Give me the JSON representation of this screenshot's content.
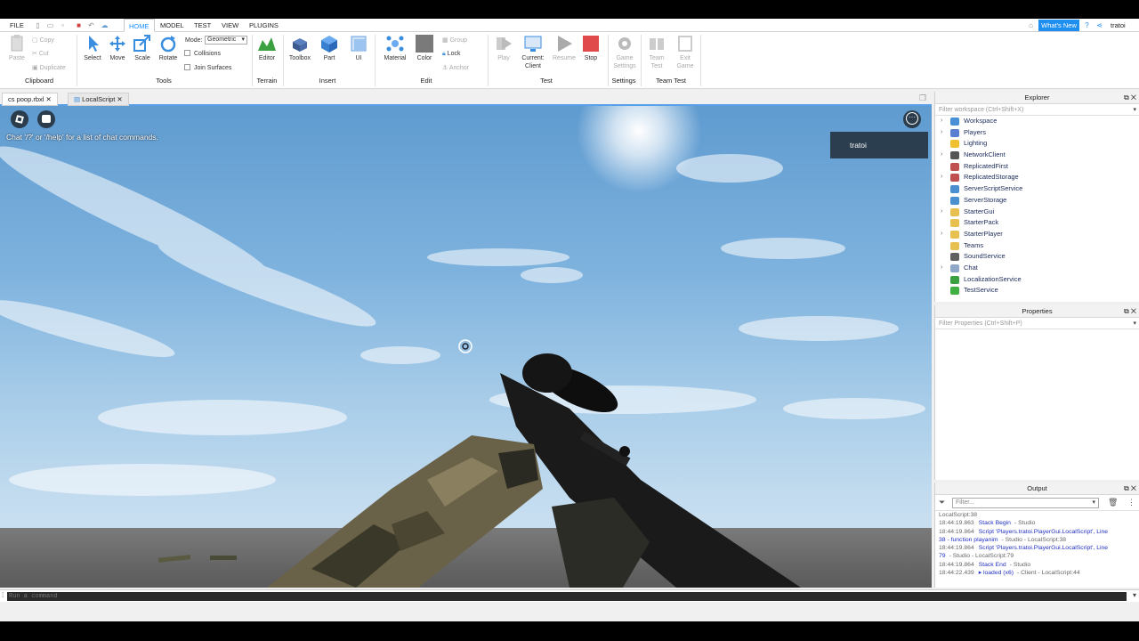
{
  "tabbar": {
    "file": "FILE",
    "tabs": [
      "HOME",
      "MODEL",
      "TEST",
      "VIEW",
      "PLUGINS"
    ],
    "whats_new": "What's New",
    "username": "tratoi"
  },
  "ribbon": {
    "clipboard": {
      "paste": "Paste",
      "copy": "Copy",
      "cut": "Cut",
      "duplicate": "Duplicate",
      "group": "Clipboard"
    },
    "tools": {
      "select": "Select",
      "move": "Move",
      "scale": "Scale",
      "rotate": "Rotate",
      "mode_label": "Mode:",
      "mode_value": "Geometric",
      "collisions": "Collisions",
      "join_surfaces": "Join Surfaces",
      "group": "Tools"
    },
    "terrain": {
      "editor": "Editor",
      "group": "Terrain"
    },
    "insert": {
      "toolbox": "Toolbox",
      "part": "Part",
      "ui": "UI",
      "group": "Insert"
    },
    "edit": {
      "material": "Material",
      "color": "Color",
      "group_btn": "Group",
      "lock": "Lock",
      "anchor": "Anchor",
      "group": "Edit"
    },
    "test": {
      "play": "Play",
      "current": "Current:",
      "client": "Client",
      "resume": "Resume",
      "stop": "Stop",
      "group": "Test"
    },
    "settings": {
      "game": "Game",
      "settings": "Settings",
      "group": "Settings"
    },
    "team_test": {
      "team": "Team",
      "test": "Test",
      "exit": "Exit",
      "game": "Game",
      "group": "Team Test"
    }
  },
  "doc_tabs": [
    {
      "label": "cs poop.rbxl"
    },
    {
      "label": "LocalScript"
    }
  ],
  "viewport": {
    "chat_hint": "Chat '/?' or '/help' for a list of chat commands.",
    "player": "tratoi"
  },
  "explorer": {
    "title": "Explorer",
    "filter": "Filter workspace (Ctrl+Shift+X)",
    "items": [
      {
        "label": "Workspace",
        "expandable": true,
        "icon_color": "#4a90d9"
      },
      {
        "label": "Players",
        "expandable": true,
        "icon_color": "#5a7fd0"
      },
      {
        "label": "Lighting",
        "expandable": false,
        "icon_color": "#f0c030"
      },
      {
        "label": "NetworkClient",
        "expandable": true,
        "icon_color": "#555555"
      },
      {
        "label": "ReplicatedFirst",
        "expandable": false,
        "icon_color": "#c05050"
      },
      {
        "label": "ReplicatedStorage",
        "expandable": true,
        "icon_color": "#c05050"
      },
      {
        "label": "ServerScriptService",
        "expandable": false,
        "icon_color": "#4a8fd0"
      },
      {
        "label": "ServerStorage",
        "expandable": false,
        "icon_color": "#4a8fd0"
      },
      {
        "label": "StarterGui",
        "expandable": true,
        "icon_color": "#e8c050"
      },
      {
        "label": "StarterPack",
        "expandable": false,
        "icon_color": "#e8c050"
      },
      {
        "label": "StarterPlayer",
        "expandable": true,
        "icon_color": "#e8c050"
      },
      {
        "label": "Teams",
        "expandable": false,
        "icon_color": "#e8c050"
      },
      {
        "label": "SoundService",
        "expandable": false,
        "icon_color": "#606060"
      },
      {
        "label": "Chat",
        "expandable": true,
        "icon_color": "#8fa8c8"
      },
      {
        "label": "LocalizationService",
        "expandable": false,
        "icon_color": "#3aa040"
      },
      {
        "label": "TestService",
        "expandable": false,
        "icon_color": "#40b040"
      }
    ]
  },
  "properties": {
    "title": "Properties",
    "filter": "Filter Properties (Ctrl+Shift+P)"
  },
  "output": {
    "title": "Output",
    "filter": "Filter...",
    "lines": [
      {
        "time": "",
        "text": "LocalScript:38",
        "src": ""
      },
      {
        "time": "18:44:19.863",
        "text": "Stack Begin",
        "src": "- Studio"
      },
      {
        "time": "18:44:19.864",
        "text": "Script 'Players.tratoi.PlayerGui.LocalScript', Line",
        "src": ""
      },
      {
        "time": "",
        "text": "38 - function playanim",
        "src": "- Studio - LocalScript:38"
      },
      {
        "time": "18:44:19.864",
        "text": "Script 'Players.tratoi.PlayerGui.LocalScript', Line",
        "src": ""
      },
      {
        "time": "",
        "text": "79",
        "src": "- Studio - LocalScript:79"
      },
      {
        "time": "18:44:19.864",
        "text": "Stack End",
        "src": "- Studio"
      },
      {
        "time": "18:44:22.439",
        "text": "▸ loaded (x6)",
        "src": "- Client - LocalScript:44"
      }
    ]
  },
  "command": {
    "placeholder": "Run a command"
  }
}
